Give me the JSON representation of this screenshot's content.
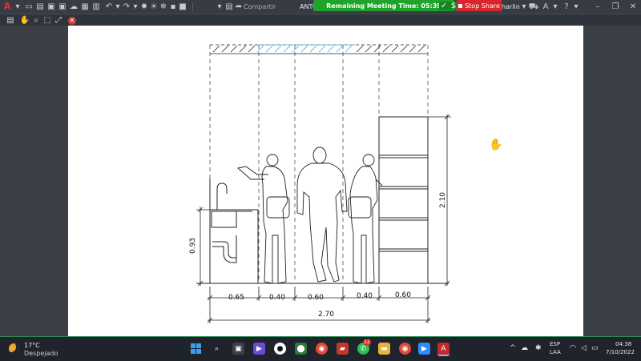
{
  "toolbar": {
    "app_letter": "A",
    "share_label": "Compartir",
    "doc_title_fragment": "ANTC",
    "meeting_time": "Remaining Meeting Time: 05:39",
    "stop_share_label": "Stop Share",
    "user_fragment": "harlin"
  },
  "drawing": {
    "dim_total": "2.70",
    "dim_segments": [
      "0.65",
      "0.40",
      "0.60",
      "0.40",
      "0.60"
    ],
    "dim_height_counter": "0.93",
    "dim_height_shelf": "2.10"
  },
  "taskbar": {
    "temperature": "17°C",
    "weather": "Despejado",
    "lang": "ESP",
    "layout": "LAA",
    "time": "04:38",
    "date": "7/10/2022",
    "whatsapp_badge": "12"
  },
  "colors": {
    "meeting_green": "#1fa32a",
    "stop_red": "#d7262e",
    "autocad_red": "#e0312b",
    "taskbar_bg": "#1f242c"
  }
}
